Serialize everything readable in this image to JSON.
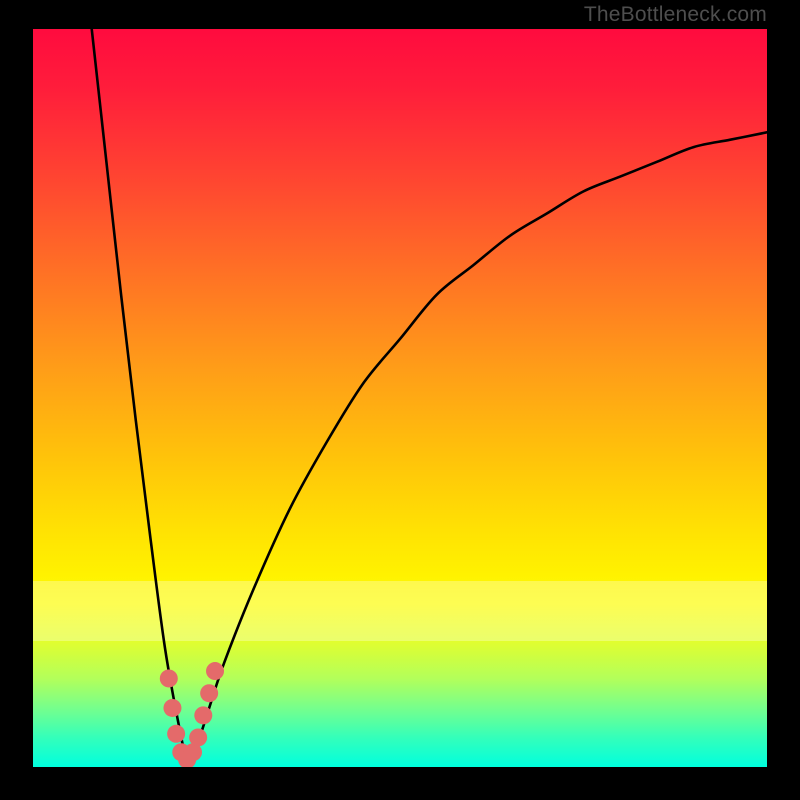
{
  "watermark": "TheBottleneck.com",
  "colors": {
    "frame_bg": "#000000",
    "curve_stroke": "#000000",
    "points_fill": "#e46a6a",
    "gradient_top": "#ff0b3e",
    "gradient_bottom": "#00ffde",
    "pale_band": "rgba(255,255,255,0.30)"
  },
  "chart_data": {
    "type": "line",
    "title": "",
    "xlabel": "",
    "ylabel": "",
    "xlim": [
      0,
      100
    ],
    "ylim": [
      0,
      100
    ],
    "grid": false,
    "legend": false,
    "series": [
      {
        "name": "bottleneck-curve",
        "x": [
          8,
          10,
          12,
          14,
          16,
          18,
          20,
          21,
          22,
          24,
          26,
          30,
          35,
          40,
          45,
          50,
          55,
          60,
          65,
          70,
          75,
          80,
          85,
          90,
          95,
          100
        ],
        "y": [
          100,
          82,
          64,
          47,
          31,
          16,
          5,
          1,
          2,
          8,
          14,
          24,
          35,
          44,
          52,
          58,
          64,
          68,
          72,
          75,
          78,
          80,
          82,
          84,
          85,
          86
        ]
      }
    ],
    "points": [
      {
        "x": 18.5,
        "y": 12
      },
      {
        "x": 19.0,
        "y": 8
      },
      {
        "x": 19.5,
        "y": 4.5
      },
      {
        "x": 20.2,
        "y": 2
      },
      {
        "x": 21.0,
        "y": 1
      },
      {
        "x": 21.8,
        "y": 2
      },
      {
        "x": 22.5,
        "y": 4
      },
      {
        "x": 23.2,
        "y": 7
      },
      {
        "x": 24.0,
        "y": 10
      },
      {
        "x": 24.8,
        "y": 13
      }
    ],
    "pale_band_y": [
      17,
      25
    ]
  }
}
